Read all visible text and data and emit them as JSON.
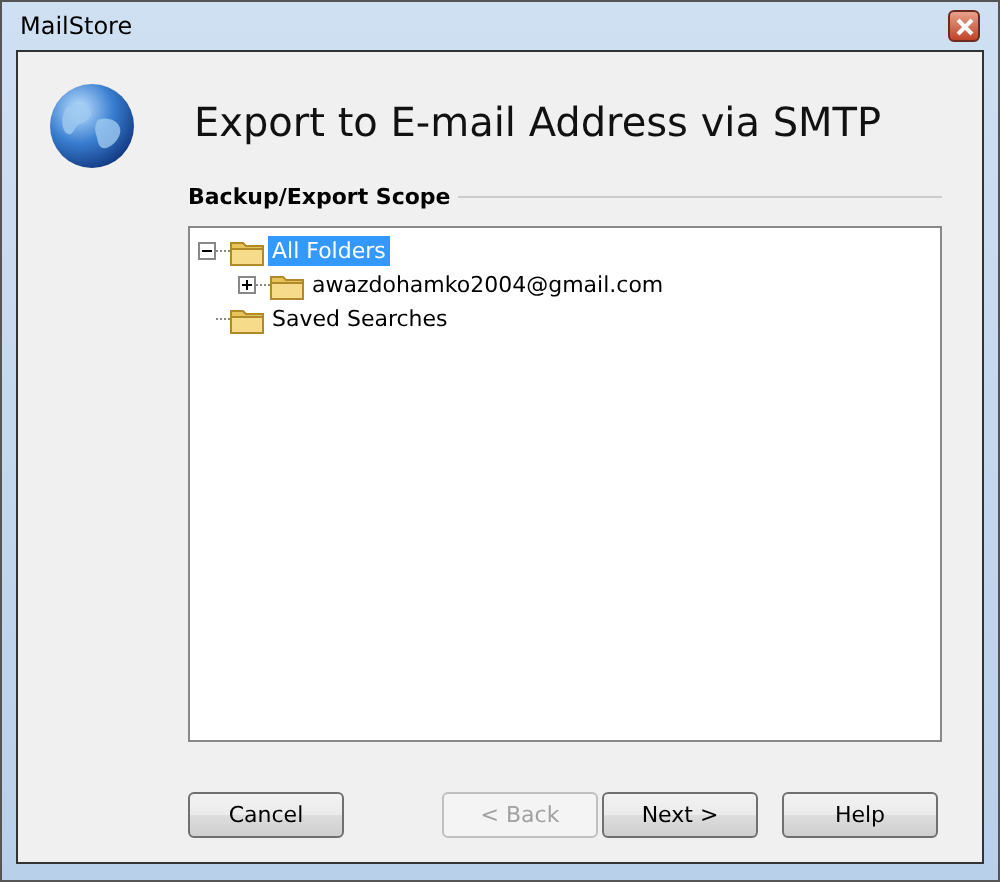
{
  "window": {
    "title": "MailStore"
  },
  "heading": "Export to E-mail Address via SMTP",
  "section": "Backup/Export Scope",
  "tree": [
    {
      "label": "All Folders",
      "kind": "collapsible",
      "expanded": true,
      "selected": true,
      "children": [
        {
          "label": "awazdohamko2004@gmail.com",
          "kind": "collapsible",
          "expanded": false,
          "selected": false
        }
      ]
    },
    {
      "label": "Saved Searches",
      "kind": "leaf",
      "selected": false
    }
  ],
  "buttons": [
    {
      "label": "Cancel",
      "disabled": false
    },
    {
      "label": "< Back",
      "disabled": true
    },
    {
      "label": "Next >",
      "disabled": false
    },
    {
      "label": "Help",
      "disabled": false
    }
  ]
}
